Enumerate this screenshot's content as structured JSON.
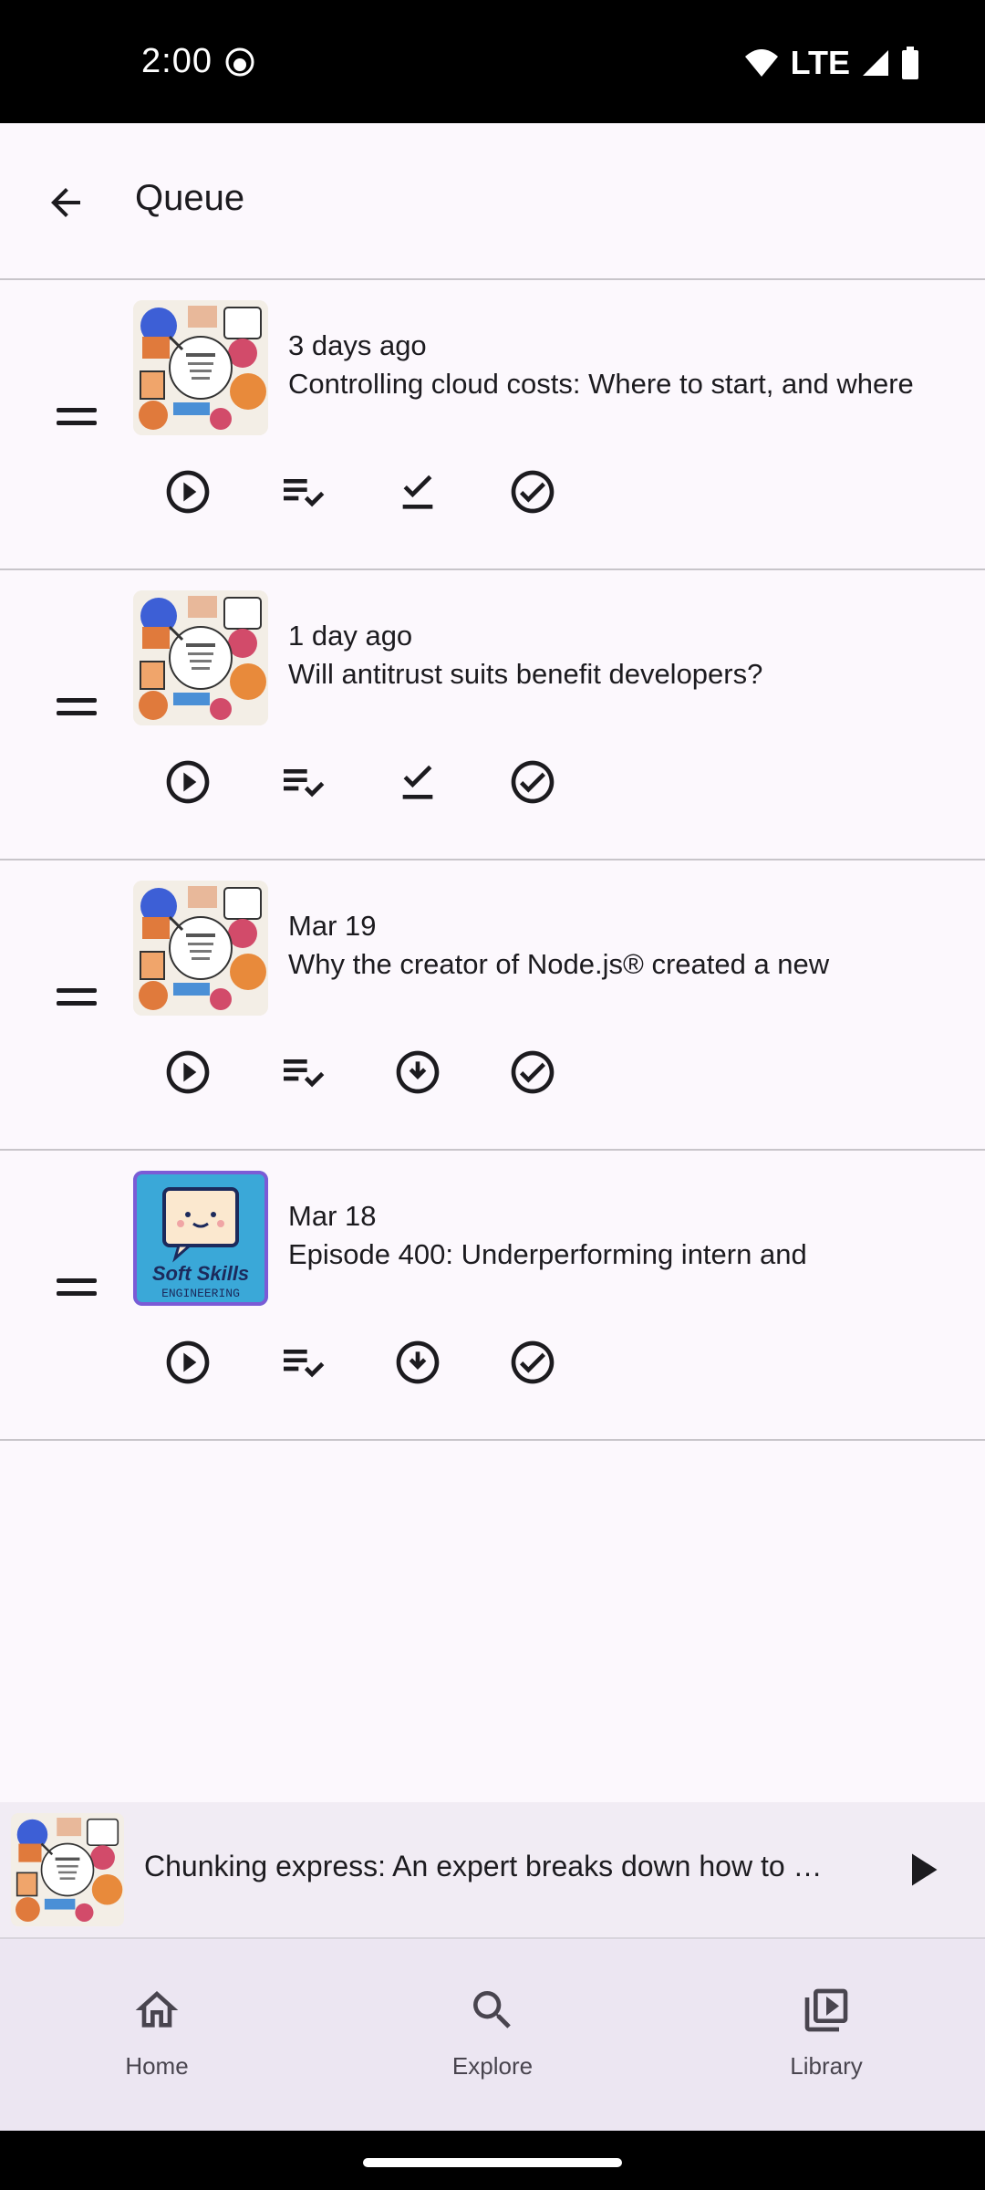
{
  "status_bar": {
    "time": "2:00",
    "network": "LTE"
  },
  "header": {
    "title": "Queue"
  },
  "queue": [
    {
      "date": "3 days ago",
      "title": "Controlling cloud costs: Where to start, and where",
      "podcast_art": "stack-overflow-podcast",
      "download_state": "downloaded"
    },
    {
      "date": "1 day ago",
      "title": "Will antitrust suits benefit developers?",
      "podcast_art": "stack-overflow-podcast",
      "download_state": "downloaded"
    },
    {
      "date": "Mar 19",
      "title": "Why the creator of Node.js® created a new",
      "podcast_art": "stack-overflow-podcast",
      "download_state": "not-downloaded"
    },
    {
      "date": "Mar 18",
      "title": "Episode 400: Underperforming intern and",
      "podcast_art": "soft-skills-engineering",
      "download_state": "not-downloaded"
    }
  ],
  "soft_skills_art": {
    "line1": "Soft Skills",
    "line2": "ENGINEERING"
  },
  "mini_player": {
    "title": "Chunking express: An expert breaks down how to …"
  },
  "bottom_nav": [
    {
      "label": "Home",
      "icon": "home-icon"
    },
    {
      "label": "Explore",
      "icon": "search-icon"
    },
    {
      "label": "Library",
      "icon": "library-icon"
    }
  ],
  "colors": {
    "background": "#fcf8fd",
    "nav_background": "#ece6f2",
    "mini_player_background": "#f1ecf4",
    "icon": "#1c1b1f"
  }
}
